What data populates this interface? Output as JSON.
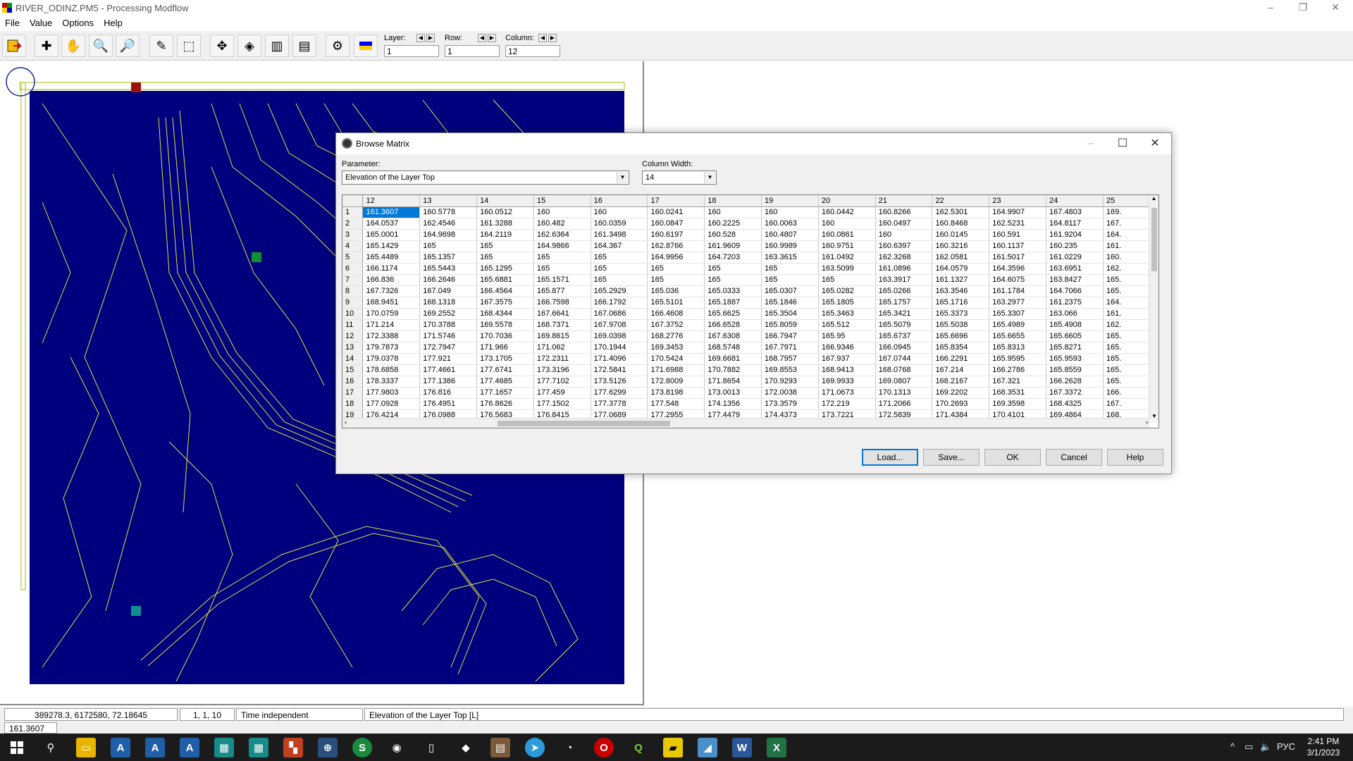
{
  "window": {
    "title": "RIVER_ODINZ.PM5 - Processing Modflow"
  },
  "menu": [
    "File",
    "Value",
    "Options",
    "Help"
  ],
  "toolbar": {
    "layer_label": "Layer:",
    "layer_value": "1",
    "row_label": "Row:",
    "row_value": "1",
    "column_label": "Column:",
    "column_value": "12"
  },
  "colors": {
    "map_bg": "#00007f",
    "contours": "#d8e040",
    "accent": "#0078d7"
  },
  "dialog": {
    "title": "Browse Matrix",
    "parameter_label": "Parameter:",
    "parameter_value": "Elevation of the Layer Top",
    "width_label": "Column Width:",
    "width_value": "14",
    "buttons": {
      "load": "Load...",
      "save": "Save...",
      "ok": "OK",
      "cancel": "Cancel",
      "help": "Help"
    },
    "columns": [
      "12",
      "13",
      "14",
      "15",
      "16",
      "17",
      "18",
      "19",
      "20",
      "21",
      "22",
      "23",
      "24",
      "25"
    ],
    "rows": [
      {
        "n": "1",
        "v": [
          "161.3607",
          "160.5778",
          "160.0512",
          "160",
          "160",
          "160.0241",
          "160",
          "160",
          "160.0442",
          "160.8266",
          "162.5301",
          "164.9907",
          "167.4803",
          "169."
        ]
      },
      {
        "n": "2",
        "v": [
          "164.0537",
          "162.4546",
          "161.3288",
          "160.482",
          "160.0359",
          "160.0847",
          "160.2225",
          "160.0063",
          "160",
          "160.0497",
          "160.8468",
          "162.5231",
          "164.8117",
          "167."
        ]
      },
      {
        "n": "3",
        "v": [
          "165.0001",
          "164.9698",
          "164.2119",
          "162.6364",
          "161.3498",
          "160.6197",
          "160.528",
          "160.4807",
          "160.0861",
          "160",
          "160.0145",
          "160.591",
          "161.9204",
          "164."
        ]
      },
      {
        "n": "4",
        "v": [
          "165.1429",
          "165",
          "165",
          "164.9866",
          "164.367",
          "162.8766",
          "161.9609",
          "160.9989",
          "160.9751",
          "160.6397",
          "160.3216",
          "160.1137",
          "160.235",
          "161."
        ]
      },
      {
        "n": "5",
        "v": [
          "165.4489",
          "165.1357",
          "165",
          "165",
          "165",
          "164.9956",
          "164.7203",
          "163.3615",
          "161.0492",
          "162.3268",
          "162.0581",
          "161.5017",
          "161.0229",
          "160."
        ]
      },
      {
        "n": "6",
        "v": [
          "166.1174",
          "165.5443",
          "165.1295",
          "165",
          "165",
          "165",
          "165",
          "165",
          "163.5099",
          "161.0896",
          "164.0579",
          "164.3596",
          "163.6951",
          "162."
        ]
      },
      {
        "n": "7",
        "v": [
          "166.836",
          "166.2646",
          "165.6881",
          "165.1571",
          "165",
          "165",
          "165",
          "165",
          "165",
          "163.3917",
          "161.1327",
          "164.6075",
          "163.8427",
          "165."
        ]
      },
      {
        "n": "8",
        "v": [
          "167.7326",
          "167.049",
          "166.4564",
          "165.877",
          "165.2929",
          "165.036",
          "165.0333",
          "165.0307",
          "165.0282",
          "165.0266",
          "163.3546",
          "161.1784",
          "164.7066",
          "165."
        ]
      },
      {
        "n": "9",
        "v": [
          "168.9451",
          "168.1318",
          "167.3575",
          "166.7598",
          "166.1792",
          "165.5101",
          "165.1887",
          "165.1846",
          "165.1805",
          "165.1757",
          "165.1716",
          "163.2977",
          "161.2375",
          "164."
        ]
      },
      {
        "n": "10",
        "v": [
          "170.0759",
          "169.2552",
          "168.4344",
          "167.6641",
          "167.0686",
          "166.4608",
          "165.6625",
          "165.3504",
          "165.3463",
          "165.3421",
          "165.3373",
          "165.3307",
          "163.066",
          "161."
        ]
      },
      {
        "n": "11",
        "v": [
          "171.214",
          "170.3788",
          "169.5578",
          "168.7371",
          "167.9708",
          "167.3752",
          "166.6528",
          "165.8059",
          "165.512",
          "165.5079",
          "165.5038",
          "165.4989",
          "165.4908",
          "162."
        ]
      },
      {
        "n": "12",
        "v": [
          "172.3388",
          "171.5746",
          "170.7036",
          "169.8615",
          "169.0398",
          "168.2776",
          "167.6308",
          "166.7947",
          "165.95",
          "165.6737",
          "165.6696",
          "165.6655",
          "165.6605",
          "165."
        ]
      },
      {
        "n": "13",
        "v": [
          "179.7873",
          "172.7947",
          "171.966",
          "171.062",
          "170.1944",
          "169.3453",
          "168.5748",
          "167.7971",
          "166.9346",
          "166.0945",
          "165.8354",
          "165.8313",
          "165.8271",
          "165."
        ]
      },
      {
        "n": "14",
        "v": [
          "179.0378",
          "177.921",
          "173.1705",
          "172.2311",
          "171.4096",
          "170.5424",
          "169.6681",
          "168.7957",
          "167.937",
          "167.0744",
          "166.2291",
          "165.9595",
          "165.9593",
          "165."
        ]
      },
      {
        "n": "15",
        "v": [
          "178.6858",
          "177.4661",
          "177.6741",
          "173.3196",
          "172.5841",
          "171.6988",
          "170.7882",
          "169.8553",
          "168.9413",
          "168.0768",
          "167.214",
          "166.2786",
          "165.8559",
          "165."
        ]
      },
      {
        "n": "16",
        "v": [
          "178.3337",
          "177.1386",
          "177.4685",
          "177.7102",
          "173.5126",
          "172.8009",
          "171.8654",
          "170.9293",
          "169.9933",
          "169.0807",
          "168.2167",
          "167.321",
          "166.2628",
          "165."
        ]
      },
      {
        "n": "17",
        "v": [
          "177.9803",
          "176.816",
          "177.1657",
          "177.459",
          "177.6299",
          "173.8198",
          "173.0013",
          "172.0038",
          "171.0673",
          "170.1313",
          "169.2202",
          "168.3531",
          "167.3372",
          "166."
        ]
      },
      {
        "n": "18",
        "v": [
          "177.0928",
          "176.4951",
          "176.8626",
          "177.1502",
          "177.3778",
          "177.548",
          "174.1356",
          "173.3579",
          "172.219",
          "171.2066",
          "170.2693",
          "169.3598",
          "168.4325",
          "167."
        ]
      },
      {
        "n": "19",
        "v": [
          "176.4214",
          "176.0988",
          "176.5683",
          "176.8415",
          "177.0689",
          "177.2955",
          "177.4479",
          "174.4373",
          "173.7221",
          "172.5839",
          "171.4384",
          "170.4101",
          "169.4864",
          "168."
        ]
      }
    ]
  },
  "status": {
    "coords": "389278.3,  6172580,  72.18645",
    "cell": "1, 1, 10",
    "time": "Time independent",
    "param": "Elevation of the Layer Top [L]",
    "value": "161.3607"
  },
  "taskbar": {
    "lang": "РУС",
    "time": "2:41 PM",
    "date": "3/1/2023"
  }
}
